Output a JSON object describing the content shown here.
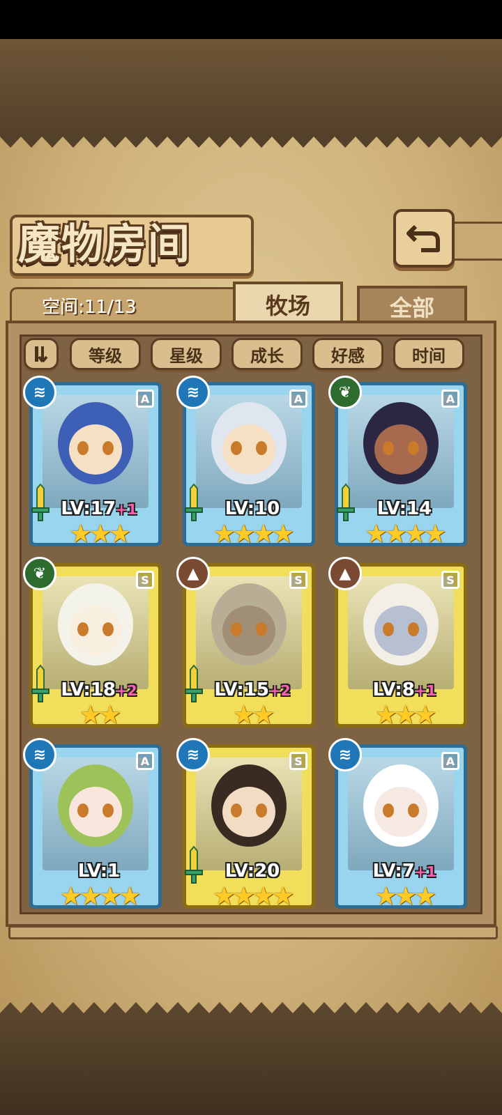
{
  "title": "魔物房间",
  "space": {
    "label": "空间:11/13"
  },
  "tabs": {
    "active": "牧场",
    "inactive": "全部"
  },
  "sort_buttons": [
    "等级",
    "星级",
    "成长",
    "好感",
    "时间"
  ],
  "cards": [
    {
      "element": "water",
      "grade": "A",
      "level": "LV:17",
      "bonus": "+1",
      "stars": "★★★",
      "frame": "blue",
      "has_sword": true
    },
    {
      "element": "water",
      "grade": "A",
      "level": "LV:10",
      "bonus": "",
      "stars": "★★★★",
      "frame": "blue",
      "has_sword": true
    },
    {
      "element": "wood",
      "grade": "A",
      "level": "LV:14",
      "bonus": "",
      "stars": "★★★★",
      "frame": "blue",
      "has_sword": true
    },
    {
      "element": "wood",
      "grade": "S",
      "level": "LV:18",
      "bonus": "+2",
      "stars": "★★",
      "frame": "gold",
      "has_sword": true
    },
    {
      "element": "earth",
      "grade": "S",
      "level": "LV:15",
      "bonus": "+2",
      "stars": "★★",
      "frame": "gold",
      "has_sword": true
    },
    {
      "element": "earth",
      "grade": "S",
      "level": "LV:8",
      "bonus": "+1",
      "stars": "★★★",
      "frame": "gold",
      "has_sword": false
    },
    {
      "element": "water",
      "grade": "A",
      "level": "LV:1",
      "bonus": "",
      "stars": "★★★★",
      "frame": "blue",
      "has_sword": false
    },
    {
      "element": "water",
      "grade": "S",
      "level": "LV:20",
      "bonus": "",
      "stars": "★★★★",
      "frame": "gold",
      "has_sword": true
    },
    {
      "element": "water",
      "grade": "A",
      "level": "LV:7",
      "bonus": "+1",
      "stars": "★★★",
      "frame": "blue",
      "has_sword": false
    }
  ],
  "icons": {
    "back": "back-arrow-icon",
    "sort_toggle": "sort-order-icon"
  },
  "colors": {
    "blue_frame": "#2c6c95",
    "gold_frame": "#8a6c12",
    "star": "#ffcb24",
    "bonus": "#ff5fb0"
  }
}
